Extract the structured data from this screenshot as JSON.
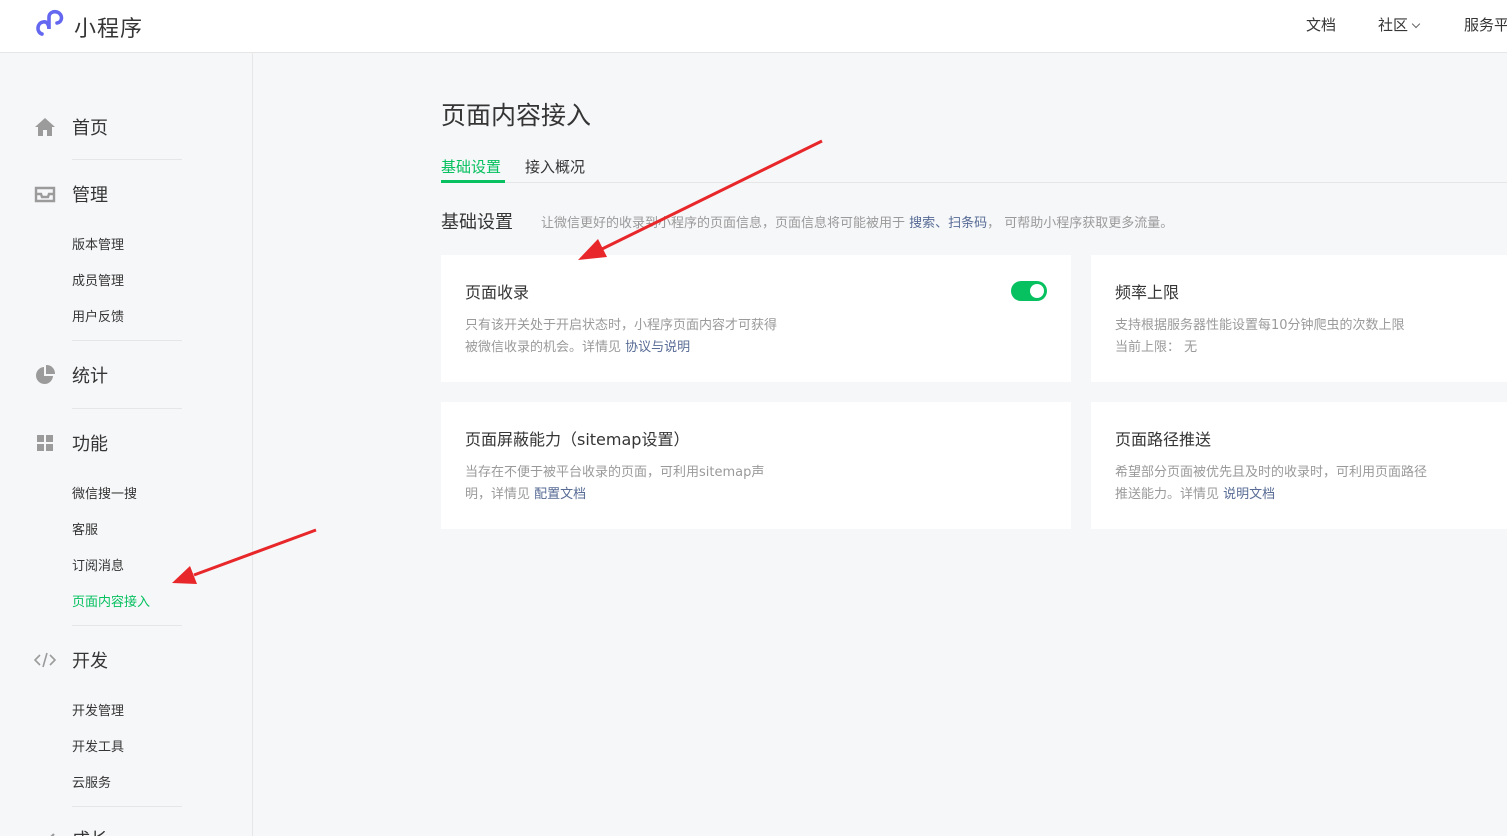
{
  "header": {
    "app_name": "小程序",
    "nav": [
      "文档",
      "社区",
      "服务平"
    ]
  },
  "sidebar": {
    "home": "首页",
    "manage": {
      "label": "管理",
      "items": [
        "版本管理",
        "成员管理",
        "用户反馈"
      ]
    },
    "stats": "统计",
    "features": {
      "label": "功能",
      "items": [
        "微信搜一搜",
        "客服",
        "订阅消息",
        "页面内容接入"
      ]
    },
    "dev": {
      "label": "开发",
      "items": [
        "开发管理",
        "开发工具",
        "云服务"
      ]
    },
    "growth": "成长"
  },
  "main": {
    "title": "页面内容接入",
    "tabs": [
      "基础设置",
      "接入概况"
    ],
    "section_title": "基础设置",
    "section_desc_before": "让微信更好的收录到小程序的页面信息，页面信息将可能被用于 ",
    "section_desc_link": "搜索、扫条码",
    "section_desc_after": "， 可帮助小程序获取更多流量。",
    "cards": {
      "indexing": {
        "title": "页面收录",
        "line1": "只有该开关处于开启状态时，小程序页面内容才可获得",
        "line2": "被微信收录的机会。详情见 ",
        "link": "协议与说明",
        "enabled": true
      },
      "frequency": {
        "title": "频率上限",
        "line1": "支持根据服务器性能设置每10分钟爬虫的次数上限",
        "line2": "当前上限：  无"
      },
      "sitemap": {
        "title": "页面屏蔽能力（sitemap设置）",
        "line1": "当存在不便于被平台收录的页面，可利用sitemap声",
        "line2": "明，详情见 ",
        "link": "配置文档"
      },
      "path_push": {
        "title": "页面路径推送",
        "line1": "希望部分页面被优先且及时的收录时，可利用页面路径",
        "line2": "推送能力。详情见 ",
        "link": "说明文档"
      }
    }
  },
  "colors": {
    "accent": "#07c160",
    "link": "#576b95",
    "annotation": "#e8272a"
  }
}
